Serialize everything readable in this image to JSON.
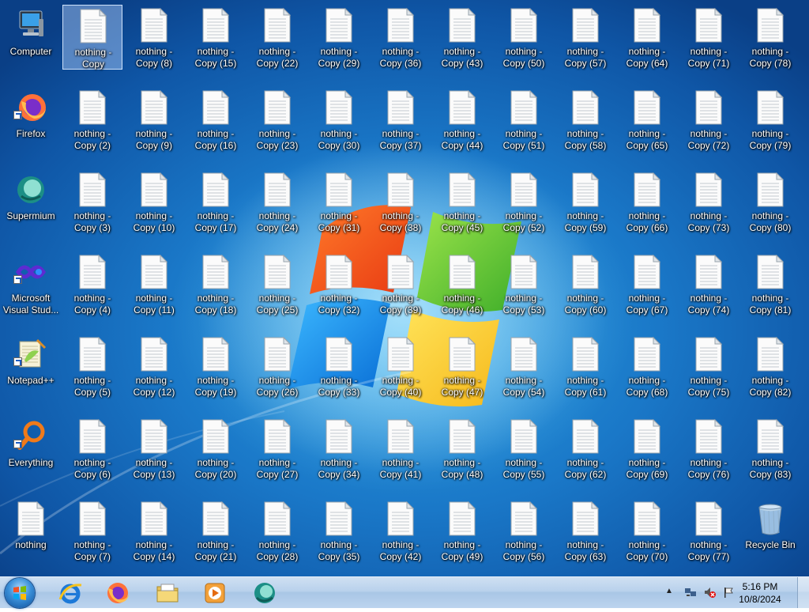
{
  "desktop": {
    "icons": [
      {
        "label": "Computer",
        "type": "computer",
        "col": 0,
        "row": 0,
        "shortcut": false
      },
      {
        "label": "Firefox",
        "type": "firefox",
        "col": 0,
        "row": 1,
        "shortcut": true
      },
      {
        "label": "Supermium",
        "type": "supermium",
        "col": 0,
        "row": 2,
        "shortcut": false
      },
      {
        "label": "Microsoft\nVisual Stud...",
        "type": "vstudio",
        "col": 0,
        "row": 3,
        "shortcut": true
      },
      {
        "label": "Notepad++",
        "type": "notepadpp",
        "col": 0,
        "row": 4,
        "shortcut": true
      },
      {
        "label": "Everything",
        "type": "everything",
        "col": 0,
        "row": 5,
        "shortcut": true
      },
      {
        "label": "nothing",
        "type": "file",
        "col": 0,
        "row": 6,
        "shortcut": false
      },
      {
        "label": "Recycle Bin",
        "type": "recycle",
        "col": 12,
        "row": 6,
        "shortcut": false
      }
    ],
    "file_prefix": "nothing - Copy",
    "selected_label": "nothing -\nCopy"
  },
  "taskbar": {
    "pinned": [
      {
        "name": "internet-explorer",
        "title": "Internet Explorer"
      },
      {
        "name": "firefox",
        "title": "Firefox"
      },
      {
        "name": "file-explorer",
        "title": "Windows Explorer"
      },
      {
        "name": "media-player",
        "title": "Windows Media Player"
      },
      {
        "name": "supermium",
        "title": "Supermium"
      }
    ],
    "clock_time": "5:16 PM",
    "clock_date": "10/8/2024"
  },
  "colors": {
    "taskbar": "#b9d1ec",
    "desktop_blue": "#1a78c8",
    "label_text": "#ffffff"
  }
}
